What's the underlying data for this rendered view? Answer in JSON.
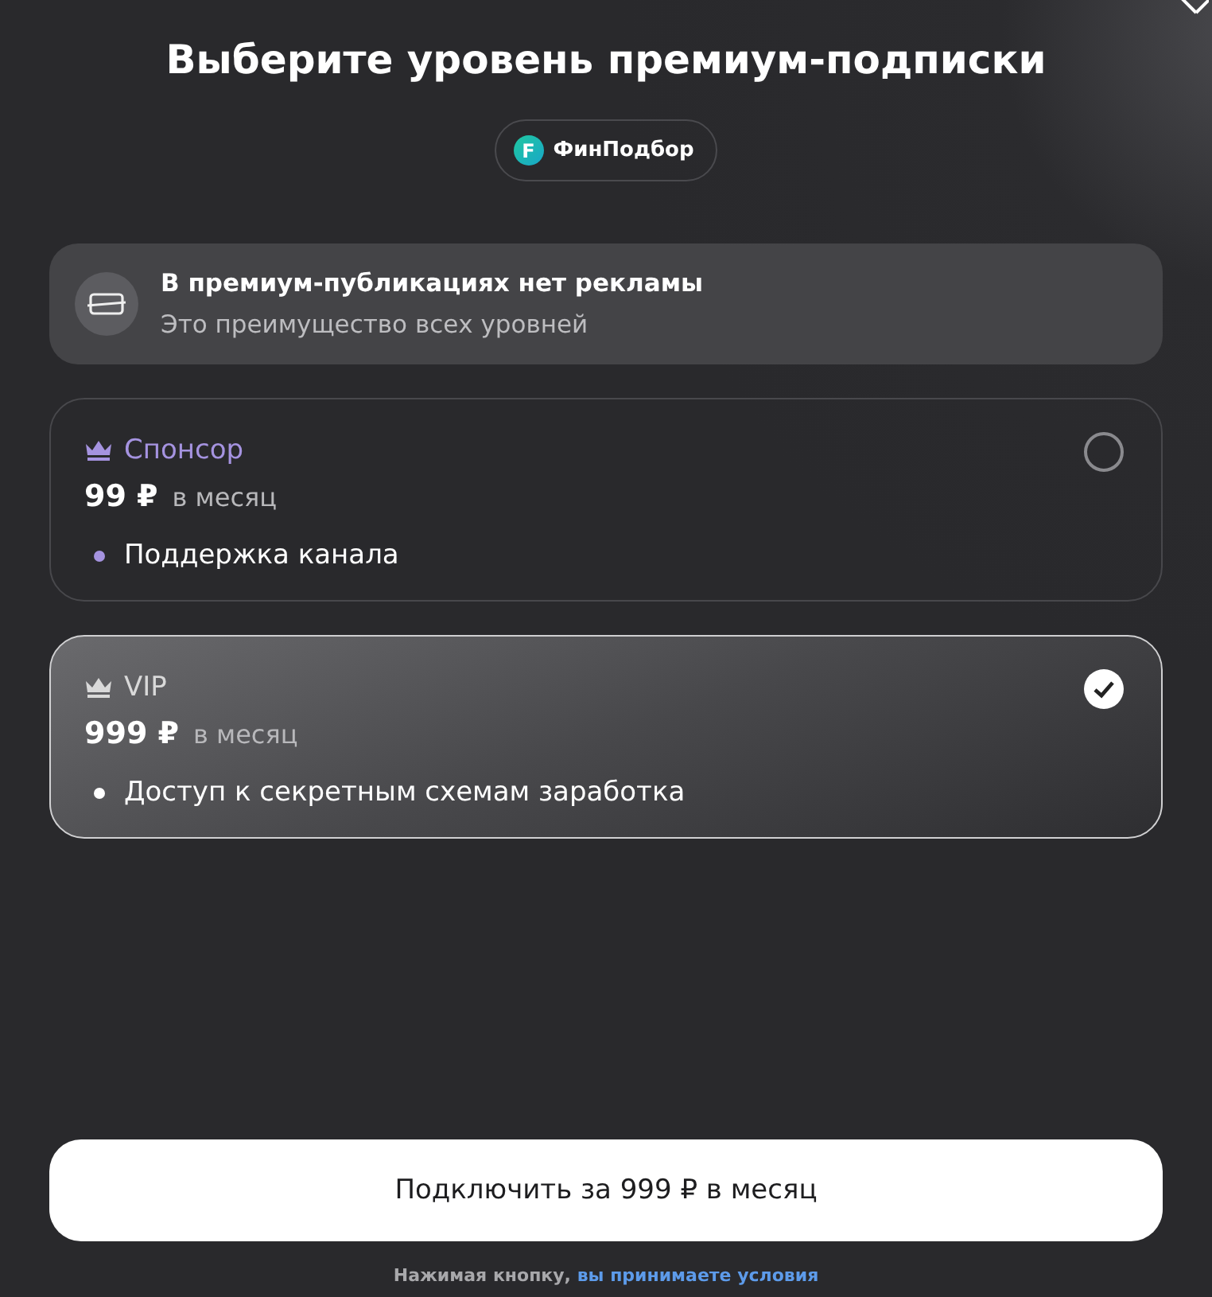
{
  "title": "Выберите уровень премиум-подписки",
  "channel": {
    "logo_letter": "F",
    "name": "ФинПодбор"
  },
  "info": {
    "title": "В премиум-публикациях нет рекламы",
    "subtitle": "Это преимущество всех уровней"
  },
  "tiers": [
    {
      "name": "Спонсор",
      "color": "#a593e0",
      "price": "99 ₽",
      "period": "в месяц",
      "features": [
        "Поддержка канала"
      ],
      "selected": false
    },
    {
      "name": "VIP",
      "color": "#d9d9d9",
      "price": "999 ₽",
      "period": "в месяц",
      "features": [
        "Доступ к секретным схемам заработка"
      ],
      "selected": true
    }
  ],
  "button": "Подключить за 999 ₽ в месяц",
  "footer": {
    "text": "Нажимая кнопку,",
    "link": "вы принимаете условия"
  }
}
